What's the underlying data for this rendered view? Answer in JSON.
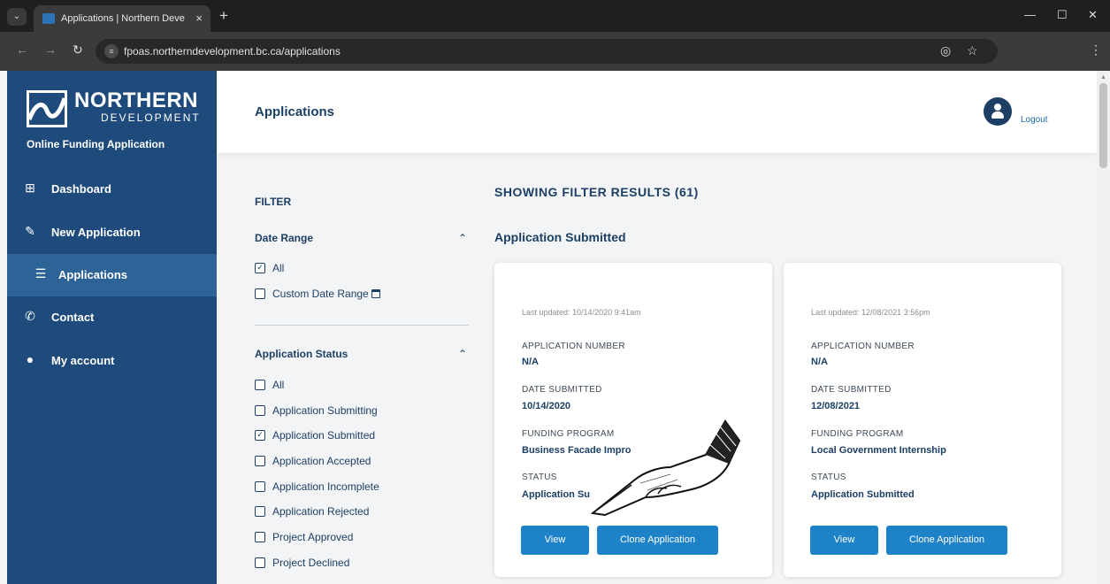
{
  "browser": {
    "tab_title": "Applications | Northern Develop",
    "url": "fpoas.northerndevelopment.bc.ca/applications",
    "new_tab": "+",
    "tab_close": "×"
  },
  "sidebar": {
    "logo_title": "NORTHERN",
    "logo_sub": "DEVELOPMENT",
    "app_subtitle": "Online Funding Application",
    "items": [
      {
        "label": "Dashboard",
        "icon": "grid-icon"
      },
      {
        "label": "New Application",
        "icon": "pencil-icon"
      },
      {
        "label": "Applications",
        "icon": "list-icon",
        "active": true
      },
      {
        "label": "Contact",
        "icon": "phone-icon"
      },
      {
        "label": "My account",
        "icon": "user-icon"
      }
    ]
  },
  "header": {
    "title": "Applications",
    "logout_label": "Logout"
  },
  "filter": {
    "title": "FILTER",
    "date_range": {
      "title": "Date Range",
      "options": [
        {
          "label": "All",
          "checked": true
        },
        {
          "label": "Custom Date Range",
          "checked": false
        }
      ]
    },
    "status": {
      "title": "Application Status",
      "options": [
        {
          "label": "All",
          "checked": false
        },
        {
          "label": "Application Submitting",
          "checked": false
        },
        {
          "label": "Application Submitted",
          "checked": true
        },
        {
          "label": "Application Accepted",
          "checked": false
        },
        {
          "label": "Application Incomplete",
          "checked": false
        },
        {
          "label": "Application Rejected",
          "checked": false
        },
        {
          "label": "Project Approved",
          "checked": false
        },
        {
          "label": "Project Declined",
          "checked": false
        }
      ]
    }
  },
  "results": {
    "heading": "SHOWING FILTER RESULTS (61)",
    "group_heading": "Application Submitted",
    "labels": {
      "app_number": "APPLICATION NUMBER",
      "date_submitted": "DATE SUBMITTED",
      "funding_program": "FUNDING PROGRAM",
      "status": "STATUS",
      "view": "View",
      "clone": "Clone Application"
    },
    "cards": [
      {
        "updated": "Last updated: 10/14/2020 9:41am",
        "app_number": "N/A",
        "date_submitted": "10/14/2020",
        "funding_program": "Business Facade Impro",
        "status": "Application Su"
      },
      {
        "updated": "Last updated: 12/08/2021 3:56pm",
        "app_number": "N/A",
        "date_submitted": "12/08/2021",
        "funding_program": "Local Government Internship",
        "status": "Application Submitted"
      }
    ]
  }
}
